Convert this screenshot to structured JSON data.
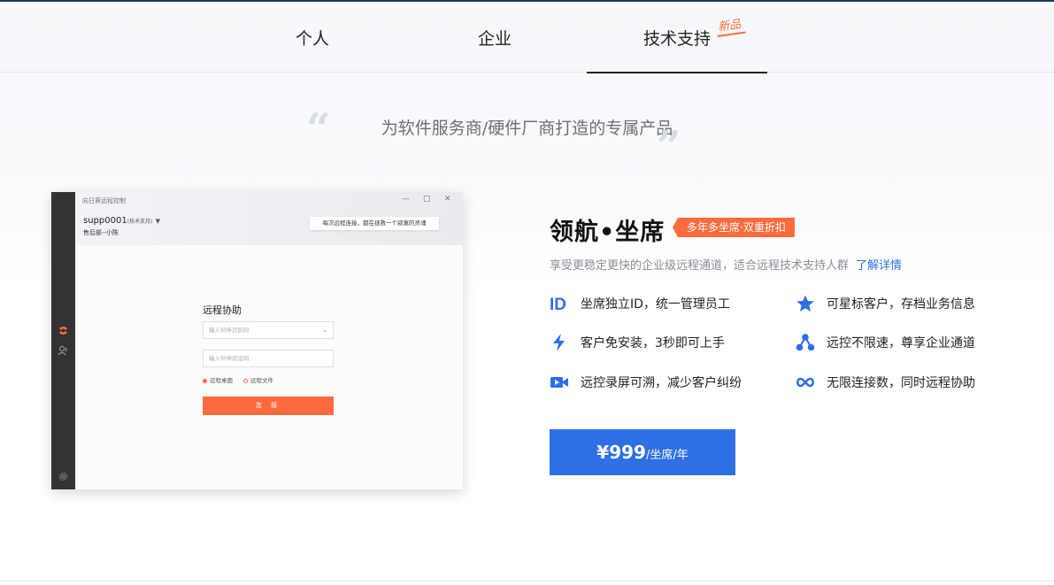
{
  "nav": {
    "tabs": [
      {
        "label": "个人"
      },
      {
        "label": "企业"
      },
      {
        "label": "技术支持",
        "badge": "新品",
        "active": true
      }
    ]
  },
  "hero": {
    "slogan": "为软件服务商/硬件厂商打造的专属产品",
    "quote_open": "“",
    "quote_close": "”"
  },
  "app_mock": {
    "window_title": "向日葵远程控制",
    "account": "supp0001",
    "account_role": "(技术支持)",
    "department": "售后部--小陈",
    "tip": "每次远程连接，都在拯救一个寂寞的灵魂",
    "section_title": "远程协助",
    "partner_id_placeholder": "输入伙伴识别码",
    "verify_code_placeholder": "输入伙伴验证码",
    "radio_options": [
      "远程桌面",
      "远程文件"
    ],
    "connect_label": "连 接"
  },
  "product": {
    "title": "领航•坐席",
    "promo": "多年多坐席·双重折扣",
    "description": "享受更稳定更快的企业级远程通道，适合远程技术支持人群",
    "more_link": "了解详情",
    "features": [
      {
        "icon": "id-icon",
        "text": "坐席独立ID，统一管理员工"
      },
      {
        "icon": "star-icon",
        "text": "可星标客户，存档业务信息"
      },
      {
        "icon": "lightning-icon",
        "text": "客户免安装，3秒即可上手"
      },
      {
        "icon": "network-icon",
        "text": "远控不限速，尊享企业通道"
      },
      {
        "icon": "video-icon",
        "text": "远控录屏可溯，减少客户纠纷"
      },
      {
        "icon": "infinity-icon",
        "text": "无限连接数，同时远程协助"
      }
    ],
    "price": "¥999",
    "price_unit": "/坐席/年"
  },
  "colors": {
    "accent_orange": "#ff6b3d",
    "primary_blue": "#2f6fe4"
  }
}
